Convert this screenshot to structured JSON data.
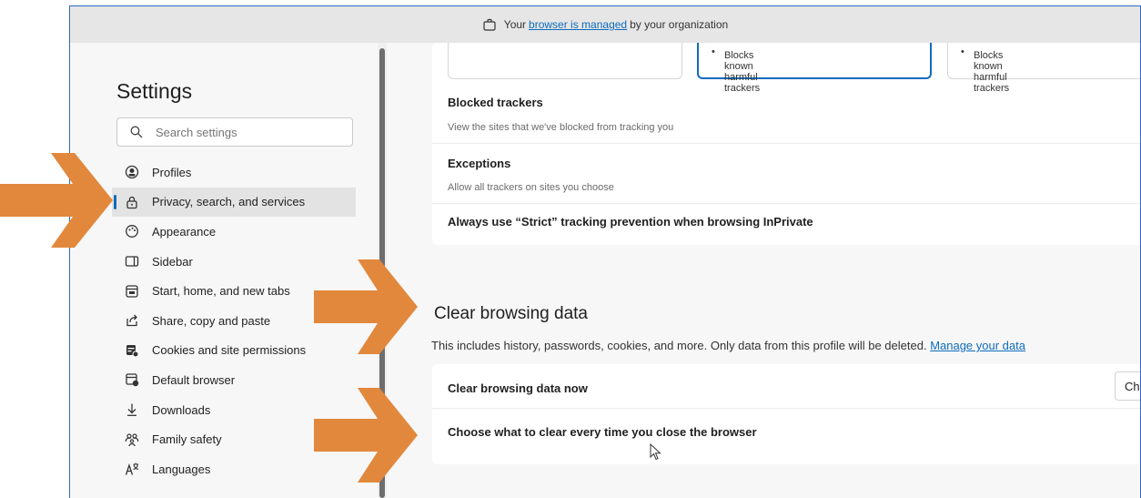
{
  "infobar": {
    "prefix": "Your",
    "link": "browser is managed",
    "suffix": "by your organization"
  },
  "sidebar": {
    "title": "Settings",
    "search_placeholder": "Search settings",
    "items": [
      {
        "label": "Profiles",
        "icon": "profiles-icon"
      },
      {
        "label": "Privacy, search, and services",
        "icon": "lock-icon",
        "active": true
      },
      {
        "label": "Appearance",
        "icon": "appearance-icon"
      },
      {
        "label": "Sidebar",
        "icon": "sidebar-icon"
      },
      {
        "label": "Start, home, and new tabs",
        "icon": "home-tabs-icon"
      },
      {
        "label": "Share, copy and paste",
        "icon": "share-icon"
      },
      {
        "label": "Cookies and site permissions",
        "icon": "cookies-icon"
      },
      {
        "label": "Default browser",
        "icon": "default-browser-icon"
      },
      {
        "label": "Downloads",
        "icon": "download-icon"
      },
      {
        "label": "Family safety",
        "icon": "family-icon"
      },
      {
        "label": "Languages",
        "icon": "languages-icon"
      }
    ]
  },
  "tracking": {
    "options": [
      {
        "bullet": "",
        "selected": false
      },
      {
        "bullet": "Blocks known harmful trackers",
        "selected": true
      },
      {
        "bullet": "Blocks known harmful trackers",
        "selected": false
      }
    ],
    "blocked_title": "Blocked trackers",
    "blocked_sub": "View the sites that we've blocked from tracking you",
    "exceptions_title": "Exceptions",
    "exceptions_sub": "Allow all trackers on sites you choose",
    "strict_title": "Always use “Strict” tracking prevention when browsing InPrivate"
  },
  "clear": {
    "title": "Clear browsing data",
    "desc": "This includes history, passwords, cookies, and more. Only data from this profile will be deleted.",
    "manage_link": "Manage your data",
    "now_label": "Clear browsing data now",
    "choose_button": "Choose what to clear",
    "every_time_label": "Choose what to clear every time you close the browser"
  },
  "annotations": {
    "arrow_color": "#e2883d"
  }
}
